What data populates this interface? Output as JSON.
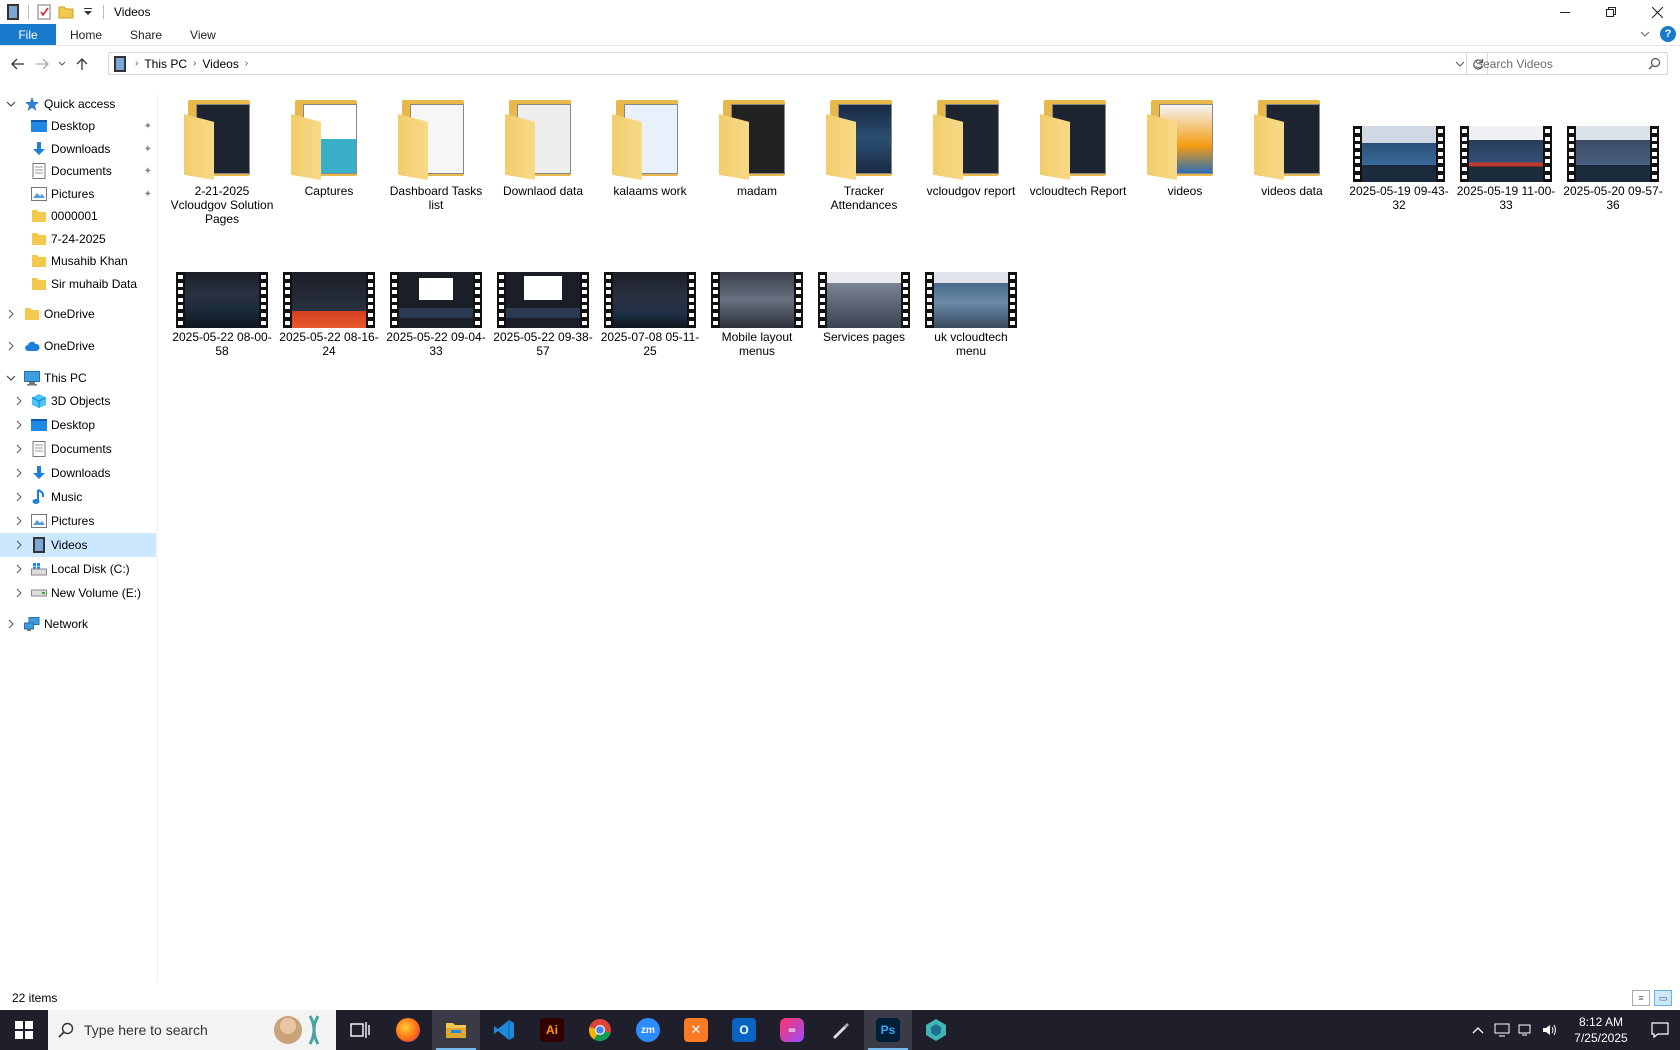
{
  "window": {
    "title": "Videos"
  },
  "ribbon": {
    "tabs": [
      "File",
      "Home",
      "Share",
      "View"
    ]
  },
  "address": {
    "crumbs": [
      "This PC",
      "Videos"
    ]
  },
  "search": {
    "placeholder": "Search Videos"
  },
  "nav": {
    "quick_access": "Quick access",
    "quick_items": [
      "Desktop",
      "Downloads",
      "Documents",
      "Pictures",
      "0000001",
      "7-24-2025",
      "Musahib Khan",
      "Sir muhaib Data"
    ],
    "onedrive1": "OneDrive",
    "onedrive2": "OneDrive",
    "this_pc": "This PC",
    "pc_items": [
      "3D Objects",
      "Desktop",
      "Documents",
      "Downloads",
      "Music",
      "Pictures",
      "Videos",
      "Local Disk (C:)",
      "New Volume (E:)"
    ],
    "network": "Network"
  },
  "items": [
    {
      "name": "2-21-2025 Vcloudgov Solution Pages",
      "type": "folder"
    },
    {
      "name": "Captures",
      "type": "folder"
    },
    {
      "name": "Dashboard Tasks list",
      "type": "folder"
    },
    {
      "name": "Downlaod data",
      "type": "folder"
    },
    {
      "name": "kalaams work",
      "type": "folder"
    },
    {
      "name": "madam",
      "type": "folder"
    },
    {
      "name": "Tracker Attendances",
      "type": "folder"
    },
    {
      "name": "vcloudgov report",
      "type": "folder"
    },
    {
      "name": "vcloudtech Report",
      "type": "folder"
    },
    {
      "name": "videos",
      "type": "folder"
    },
    {
      "name": "videos data",
      "type": "folder"
    },
    {
      "name": "2025-05-19 09-43-32",
      "type": "video"
    },
    {
      "name": "2025-05-19 11-00-33",
      "type": "video"
    },
    {
      "name": "2025-05-20 09-57-36",
      "type": "video"
    },
    {
      "name": "2025-05-22 08-00-58",
      "type": "video"
    },
    {
      "name": "2025-05-22 08-16-24",
      "type": "video"
    },
    {
      "name": "2025-05-22 09-04-33",
      "type": "video"
    },
    {
      "name": "2025-05-22 09-38-57",
      "type": "video"
    },
    {
      "name": "2025-07-08 05-11-25",
      "type": "video"
    },
    {
      "name": "Mobile layout menus",
      "type": "video"
    },
    {
      "name": "Services pages",
      "type": "video"
    },
    {
      "name": "uk vcloudtech menu",
      "type": "video"
    }
  ],
  "status": {
    "count": "22 items"
  },
  "taskbar": {
    "search_placeholder": "Type here to search",
    "time": "8:12 AM",
    "date": "7/25/2025",
    "apps": [
      "task-view",
      "firefox",
      "file-explorer",
      "vscode",
      "illustrator",
      "chrome",
      "zoom",
      "xampp",
      "outlook",
      "creative-cloud",
      "pen-tool",
      "photoshop",
      "app"
    ]
  }
}
